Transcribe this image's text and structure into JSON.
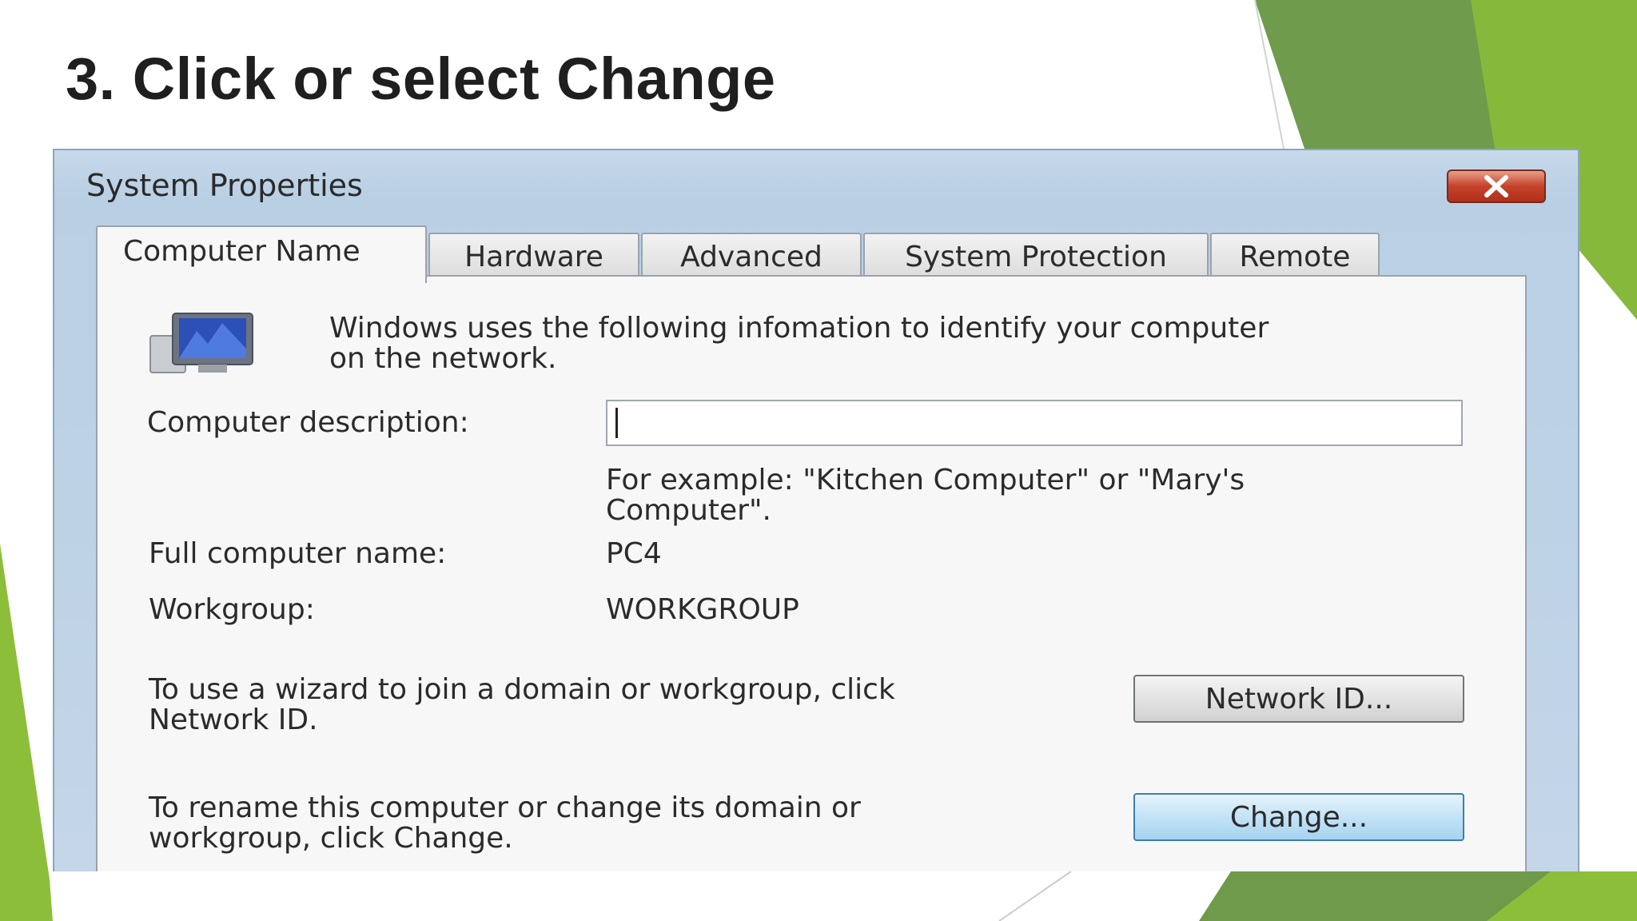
{
  "slide": {
    "title": "3. Click or select Change",
    "colors": {
      "green_light": "#8dbe3a",
      "green_dark": "#6e9a4a"
    }
  },
  "window": {
    "title": "System Properties",
    "close_icon": "close-icon"
  },
  "tabs": [
    {
      "label": "Computer Name",
      "active": true
    },
    {
      "label": "Hardware",
      "active": false
    },
    {
      "label": "Advanced",
      "active": false
    },
    {
      "label": "System Protection",
      "active": false
    },
    {
      "label": "Remote",
      "active": false
    }
  ],
  "computer_name": {
    "intro_line1": "Windows uses the following infomation to identify your computer",
    "intro_line2": "on the network.",
    "description_label": "Computer description:",
    "description_value": "",
    "example_line1": "For example: \"Kitchen Computer\" or \"Mary's",
    "example_line2": "Computer\".",
    "full_name_label": "Full computer name:",
    "full_name_value": "PC4",
    "workgroup_label": "Workgroup:",
    "workgroup_value": "WORKGROUP",
    "network_text_line1": "To use a wizard to join a domain or workgroup, click",
    "network_text_line2": "Network ID.",
    "network_button": "Network ID...",
    "rename_text_line1": "To rename this computer or change its domain or",
    "rename_text_line2": "workgroup, click Change.",
    "change_button": "Change..."
  }
}
